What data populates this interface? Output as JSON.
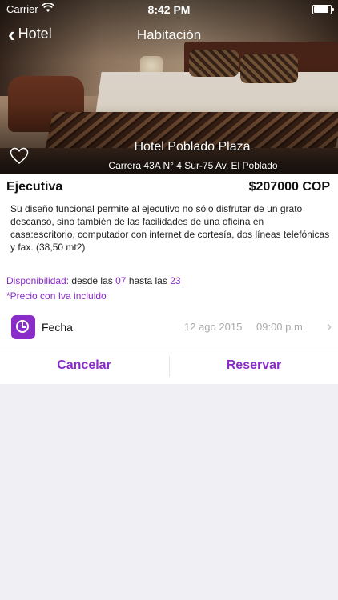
{
  "status_bar": {
    "carrier": "Carrier",
    "time": "8:42 PM",
    "battery_level": 0.9
  },
  "nav": {
    "back_label": "Hotel",
    "title": "Habitación"
  },
  "hero": {
    "hotel_name": "Hotel Poblado Plaza",
    "address": "Carrera 43A N° 4 Sur-75 Av. El Poblado",
    "favorite_icon": "heart-outline-icon"
  },
  "room": {
    "name": "Ejecutiva",
    "price": "$207000 COP",
    "description": "Su diseño funcional permite al ejecutivo no sólo disfrutar de un grato descanso, sino también de las facilidades de una oficina en casa:escritorio, computador con internet de cortesía, dos líneas telefónicas y fax. (38,50 mt2)"
  },
  "availability": {
    "label": "Disponibilidad:",
    "from_text": "desde las",
    "from": "07",
    "to_text": "hasta las",
    "to": "23"
  },
  "iva_note": "*Precio con Iva incluido",
  "date_row": {
    "label": "Fecha",
    "date": "12 ago 2015",
    "time": "09:00 p.m.",
    "icon": "clock-icon"
  },
  "actions": {
    "cancel": "Cancelar",
    "reserve": "Reservar"
  },
  "colors": {
    "accent": "#8a2cc8",
    "background": "#efeff4"
  }
}
